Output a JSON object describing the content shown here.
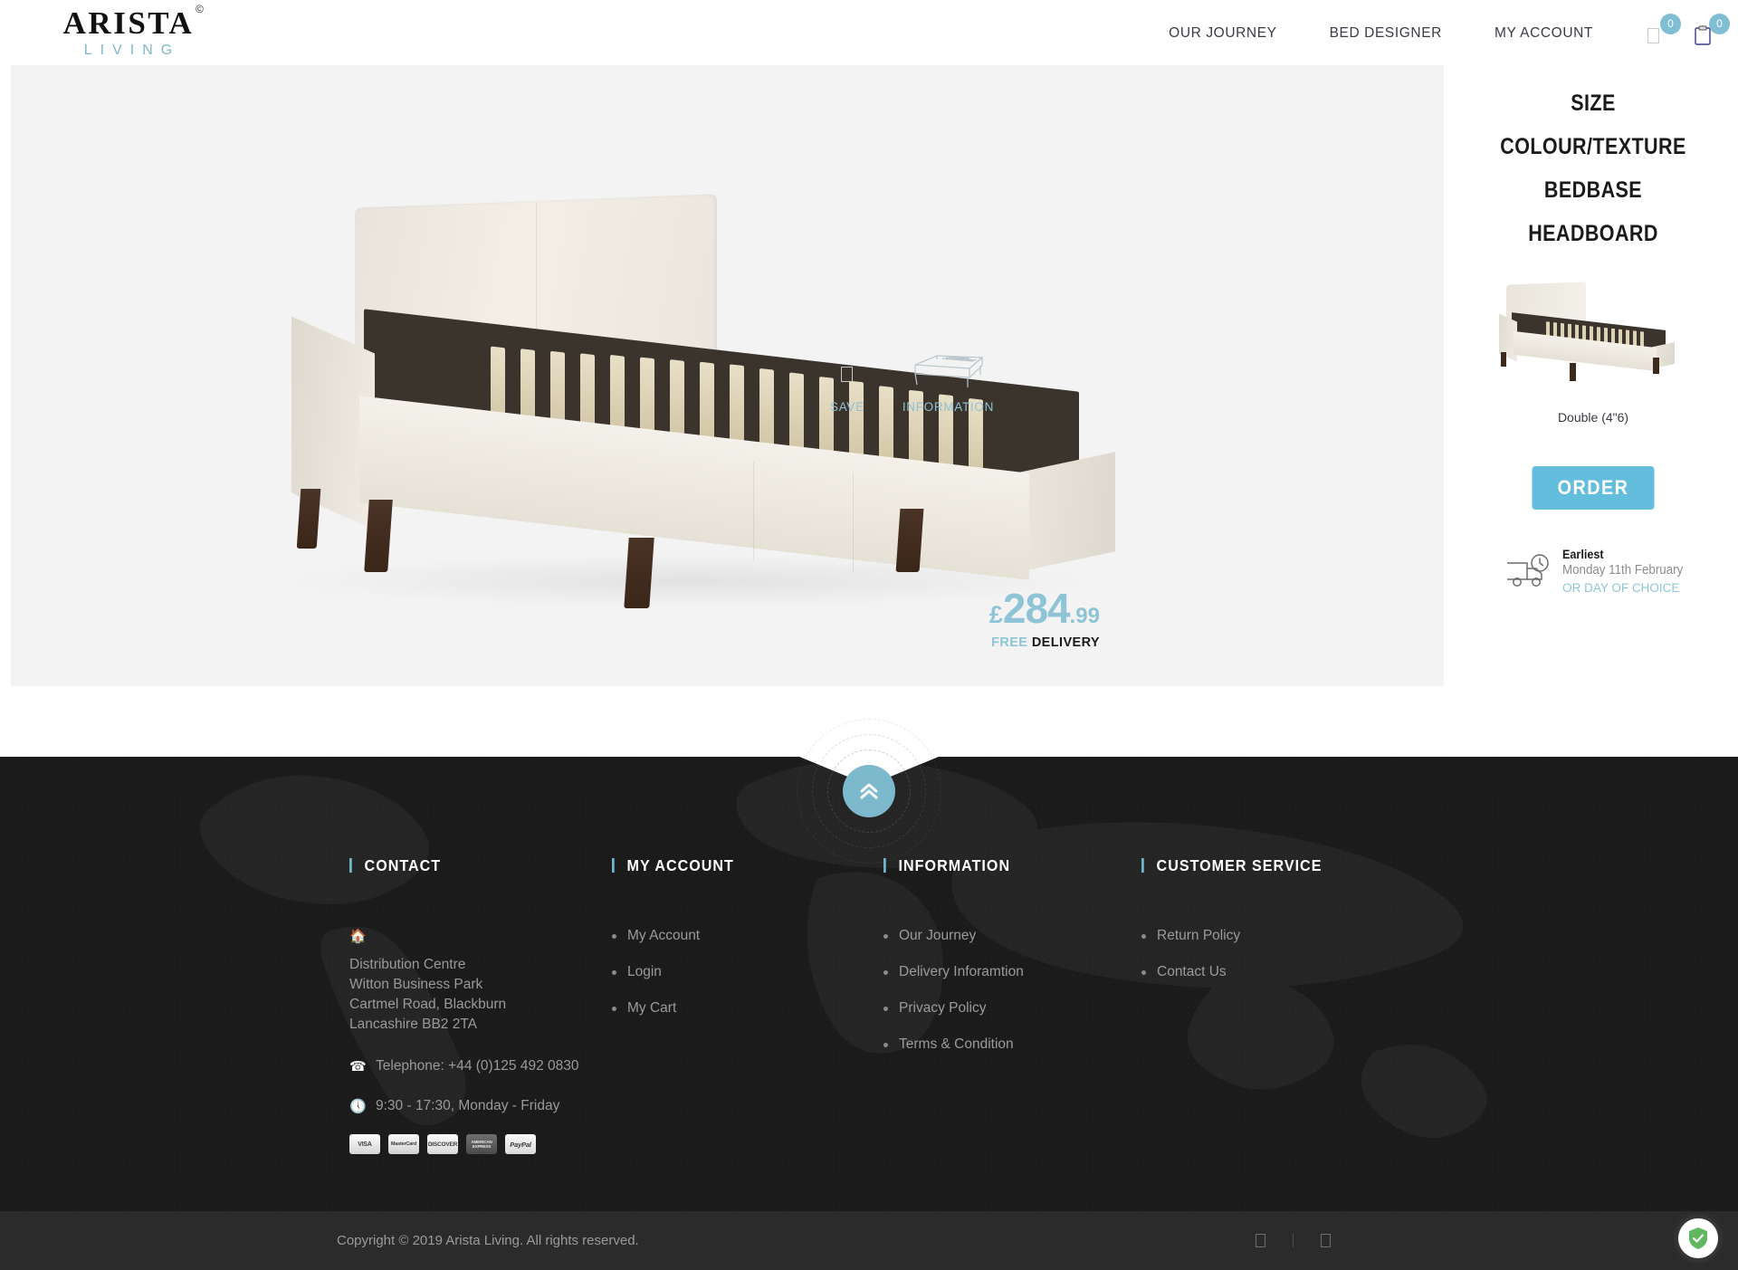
{
  "header": {
    "logo": {
      "main": "ARISTA",
      "reg": "©",
      "sub": "LIVING"
    },
    "nav": [
      {
        "label": "OUR JOURNEY",
        "name": "nav-our-journey"
      },
      {
        "label": "BED DESIGNER",
        "name": "nav-bed-designer"
      },
      {
        "label": "MY ACCOUNT",
        "name": "nav-my-account"
      }
    ],
    "icons": {
      "saved_count": "0",
      "cart_count": "0"
    }
  },
  "stage": {
    "actions": [
      {
        "label": "SAVE",
        "icon": "save-icon"
      },
      {
        "label": "INFORMATION",
        "icon": "bed-frame-icon"
      }
    ],
    "price": {
      "currency": "£",
      "integer": "284",
      "decimal": ".99",
      "free": "FREE ",
      "delivery": "DELIVERY"
    }
  },
  "config": {
    "headings": [
      {
        "label": "SIZE"
      },
      {
        "label": "COLOUR/TEXTURE"
      },
      {
        "label": "BEDBASE"
      },
      {
        "label": "HEADBOARD"
      }
    ],
    "thumb_caption": "Double (4\"6)",
    "order_label": "ORDER",
    "delivery": {
      "earliest": "Earliest",
      "date": "Monday 11th February",
      "choice": "OR DAY OF CHOICE"
    }
  },
  "footer": {
    "scroll_top_label": "scroll to top",
    "columns": [
      {
        "title": "CONTACT",
        "type": "contact",
        "address": [
          "Distribution Centre",
          "Witton Business Park",
          "Cartmel Road, Blackburn",
          "Lancashire BB2 2TA"
        ],
        "telephone": "Telephone: +44 (0)125 492 0830",
        "hours": "9:30 - 17:30, Monday - Friday",
        "cards": [
          {
            "name": "visa",
            "label": "VISA"
          },
          {
            "name": "mastercard",
            "label": "MasterCard"
          },
          {
            "name": "discover",
            "label": "DISCOVER"
          },
          {
            "name": "amex",
            "label": "AMERICAN EXPRESS"
          },
          {
            "name": "paypal",
            "label": "PayPal"
          }
        ]
      },
      {
        "title": "MY ACCOUNT",
        "type": "links",
        "links": [
          "My Account",
          "Login",
          "My Cart"
        ]
      },
      {
        "title": "INFORMATION",
        "type": "links",
        "links": [
          "Our Journey",
          "Delivery Inforamtion",
          "Privacy Policy",
          "Terms & Condition"
        ]
      },
      {
        "title": "CUSTOMER SERVICE",
        "type": "links",
        "links": [
          "Return Policy",
          "Contact Us"
        ]
      }
    ],
    "copyright": "Copyright © 2019 Arista Living. All rights reserved."
  },
  "colors": {
    "accent": "#62bedc",
    "accent_light": "#8ec4d6",
    "footer_bg": "#1b1b1b",
    "footer_bar": "#2b2b2b",
    "stage_bg": "#f3f3f3",
    "adguard_green": "#5bb85f"
  }
}
